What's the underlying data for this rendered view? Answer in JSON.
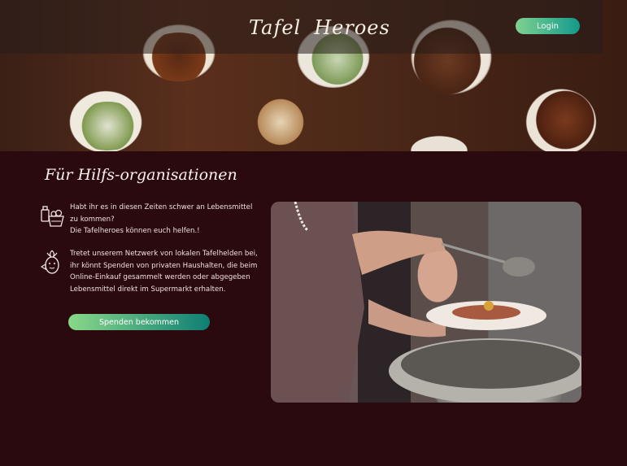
{
  "header": {
    "logo_left": "Tafel",
    "logo_right": "Heroes",
    "login_label": "Login"
  },
  "main": {
    "section_title": "Für Hilfs-organisationen",
    "block1": {
      "line1": "Habt ihr es in diesen Zeiten schwer an Lebensmittel zu kommen?",
      "line2": "Die Tafelheroes können euch helfen.!"
    },
    "block2": {
      "text": "Tretet unserem Netzwerk von lokalen Tafelhelden bei, ihr könnt Spenden von privaten Haushalten, die beim Online-Einkauf gesammelt werden oder abgegeben Lebensmittel direkt im Supermarkt erhalten."
    },
    "donate_label": "Spenden bekommen"
  },
  "icons": {
    "grocery": "grocery-basket-icon",
    "mascot": "veggie-hero-icon",
    "logo": "mascot-logo-icon"
  },
  "colors": {
    "background": "#2a0a0e",
    "button_start": "#7fd18f",
    "button_end": "#129a8d"
  }
}
